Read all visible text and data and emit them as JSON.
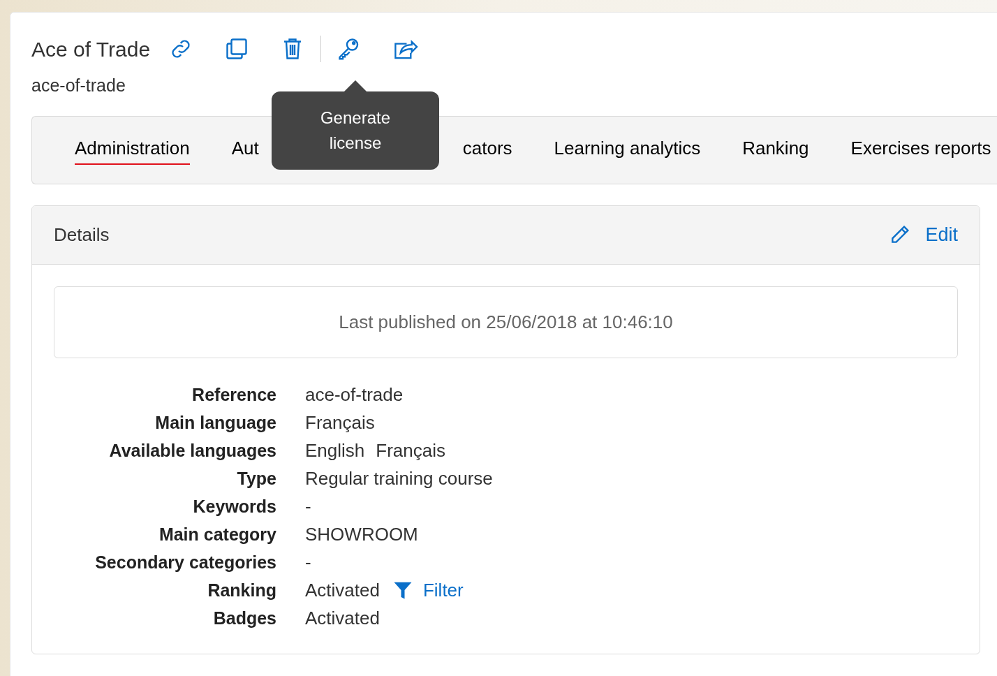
{
  "header": {
    "title": "Ace of Trade",
    "subtitle": "ace-of-trade",
    "tooltip": "Generate license"
  },
  "tabs": [
    {
      "label": "Administration",
      "selected": true
    },
    {
      "label": "Aut",
      "selected": false
    },
    {
      "label": "cators",
      "selected": false
    },
    {
      "label": "Learning analytics",
      "selected": false
    },
    {
      "label": "Ranking",
      "selected": false
    },
    {
      "label": "Exercises reports",
      "selected": false
    }
  ],
  "details": {
    "title": "Details",
    "edit_label": "Edit",
    "published": "Last published on 25/06/2018 at 10:46:10",
    "rows": [
      {
        "label": "Reference",
        "values": [
          "ace-of-trade"
        ]
      },
      {
        "label": "Main language",
        "values": [
          "Français"
        ]
      },
      {
        "label": "Available languages",
        "values": [
          "English",
          "Français"
        ]
      },
      {
        "label": "Type",
        "values": [
          "Regular training course"
        ]
      },
      {
        "label": "Keywords",
        "values": [
          "-"
        ]
      },
      {
        "label": "Main category",
        "values": [
          "SHOWROOM"
        ]
      },
      {
        "label": "Secondary categories",
        "values": [
          "-"
        ]
      },
      {
        "label": "Ranking",
        "values": [
          "Activated"
        ],
        "link": "Filter"
      },
      {
        "label": "Badges",
        "values": [
          "Activated"
        ]
      }
    ]
  }
}
